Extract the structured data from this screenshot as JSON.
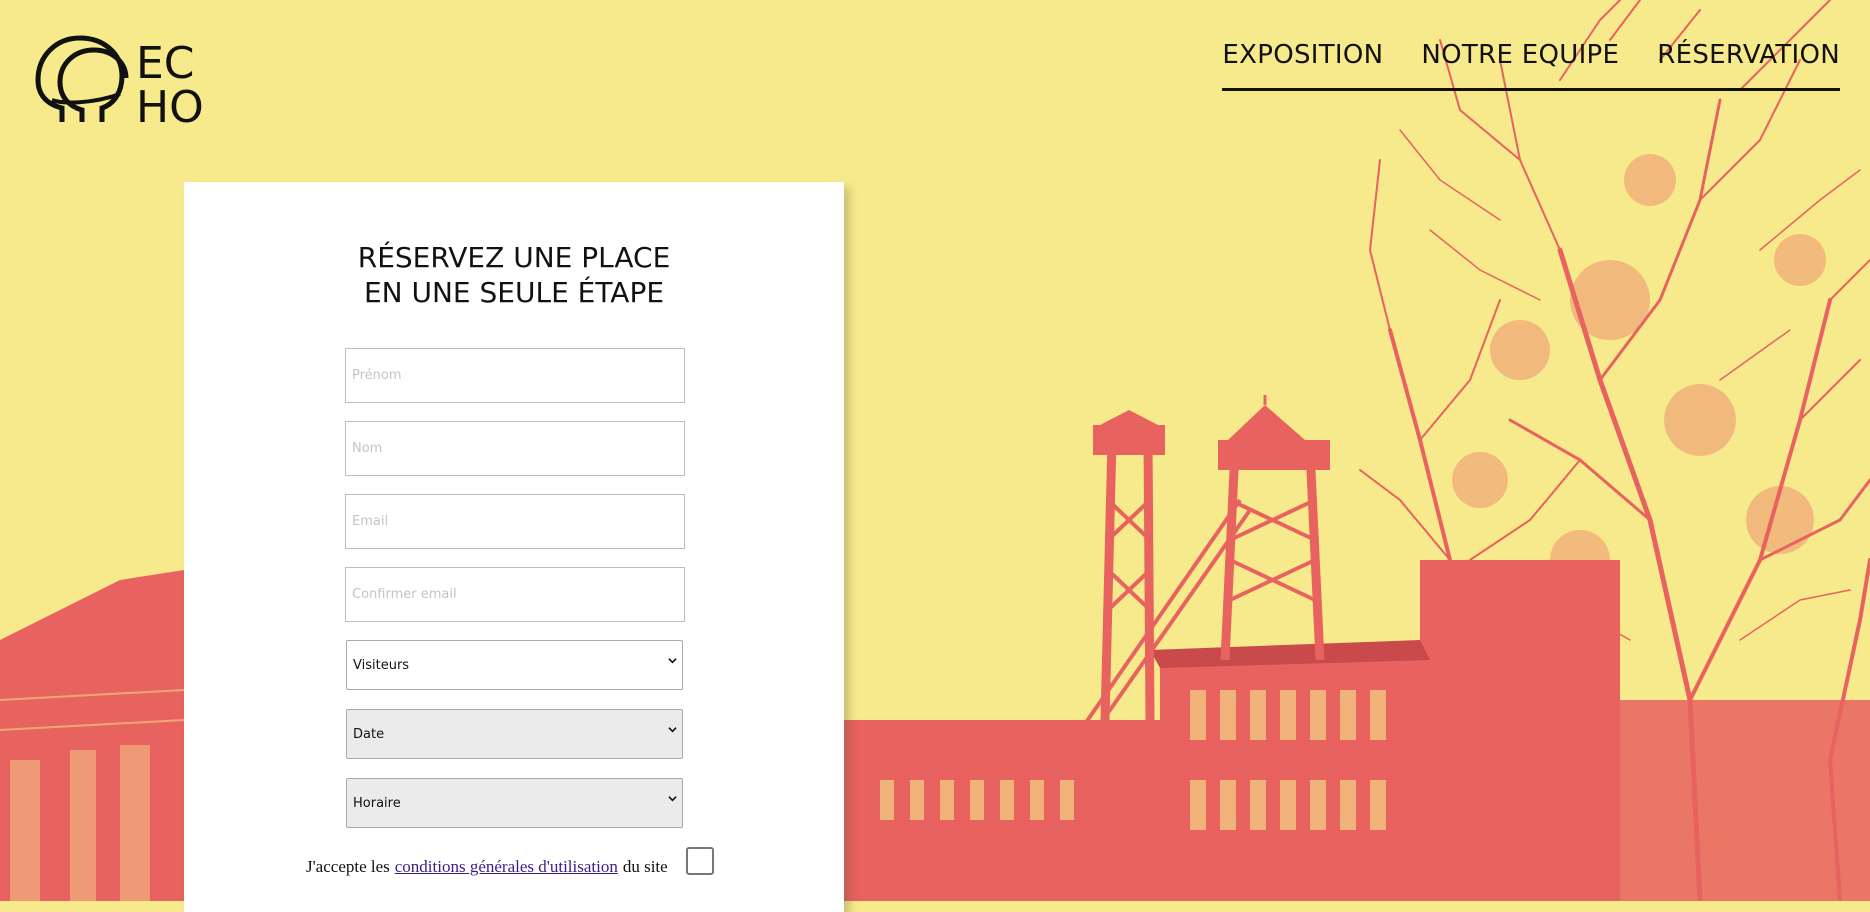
{
  "brand": {
    "logo_text": "ECHO"
  },
  "nav": {
    "items": [
      {
        "label": "EXPOSITION"
      },
      {
        "label": "NOTRE EQUIPE"
      },
      {
        "label": "RÉSERVATION"
      }
    ]
  },
  "form": {
    "title_line1": "RÉSERVEZ UNE PLACE",
    "title_line2": "EN UNE SEULE ÉTAPE",
    "first_name_placeholder": "Prénom",
    "last_name_placeholder": "Nom",
    "email_placeholder": "Email",
    "confirm_email_placeholder": "Confirmer email",
    "visitors_selected": "Visiteurs",
    "date_selected": "Date",
    "time_selected": "Horaire",
    "terms_prefix": "J'accepte les",
    "terms_link": "conditions générales d'utilisation",
    "terms_suffix": "du site",
    "terms_checked": false
  },
  "colors": {
    "background": "#f7ea8c",
    "illustration": "#e8625f",
    "text": "#111111"
  }
}
